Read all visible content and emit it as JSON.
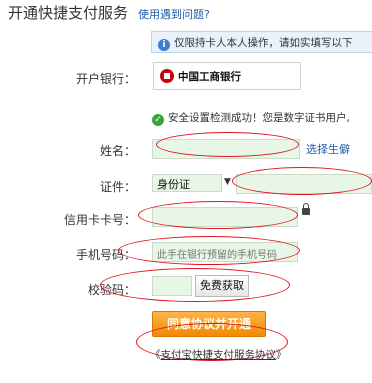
{
  "header": {
    "title": "开通快捷支付服务",
    "help_link": "使用遇到问题?"
  },
  "notice": {
    "icon": "info-icon",
    "text": "仅限持卡人本人操作，请如实填写以下"
  },
  "bank": {
    "label": "开户银行：",
    "name": "中国工商银行",
    "logo_color": "#c7000b"
  },
  "security": {
    "icon": "check-circle-icon",
    "text": "安全设置检测成功！您是数字证书用户,"
  },
  "form": {
    "name_label": "姓名：",
    "name_value": "",
    "name_side_link": "选择生僻",
    "id_label": "证件：",
    "id_type": "身份证",
    "id_number": "",
    "card_label": "信用卡卡号：",
    "card_value": "",
    "phone_label": "手机号码：",
    "phone_placeholder": "此手在银行预留的手机号码",
    "code_label": "校验码：",
    "code_value": "",
    "code_button": "免费获取"
  },
  "actions": {
    "agree_button": "同意协议并开通",
    "protocol_prefix": "《",
    "protocol_text": "支付宝快捷支付服务协议",
    "protocol_suffix": "》"
  },
  "colors": {
    "annotation_red": "#e0141e",
    "link_blue": "#1f5ca8",
    "button_orange": "#f08a00",
    "input_green": "#e7f6e7"
  }
}
